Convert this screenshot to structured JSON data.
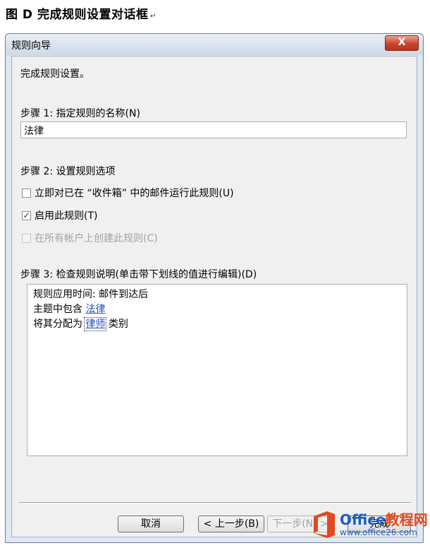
{
  "caption": {
    "title": "图 D  完成规则设置对话框",
    "return_mark": "↵"
  },
  "window": {
    "title": "规则向导",
    "close_label": "X"
  },
  "intro": "完成规则设置。",
  "step1": {
    "label": "步骤 1: 指定规则的名称(N)",
    "value": "法律"
  },
  "step2": {
    "label": "步骤 2: 设置规则选项",
    "options": [
      {
        "label": "立即对已在 “收件箱” 中的邮件运行此规则(U)",
        "checked": false,
        "enabled": true,
        "mark": ""
      },
      {
        "label": "启用此规则(T)",
        "checked": true,
        "enabled": true,
        "mark": "✓"
      },
      {
        "label": "在所有帐户上创建此规则(C)",
        "checked": false,
        "enabled": false,
        "mark": ""
      }
    ]
  },
  "step3": {
    "label": "步骤 3: 检查规则说明(单击带下划线的值进行编辑)(D)",
    "line1": "规则应用时间: 邮件到达后",
    "line2_prefix": "主题中包含 ",
    "line2_link": "法律",
    "line3_prefix": "将其分配为 ",
    "line3_link": "律师",
    "line3_suffix": " 类别"
  },
  "buttons": {
    "cancel": "取消",
    "back": "< 上一步(B)",
    "next": "下一步(N) >",
    "finish": "完成"
  },
  "watermark": {
    "brand_part1": "Office",
    "brand_part2": "教程网",
    "url": "www.office26.com"
  },
  "colors": {
    "link": "#1f4fb5",
    "title_bar": "#cfd9e6",
    "close": "#c7452b",
    "brand_orange": "#e04a1f"
  }
}
